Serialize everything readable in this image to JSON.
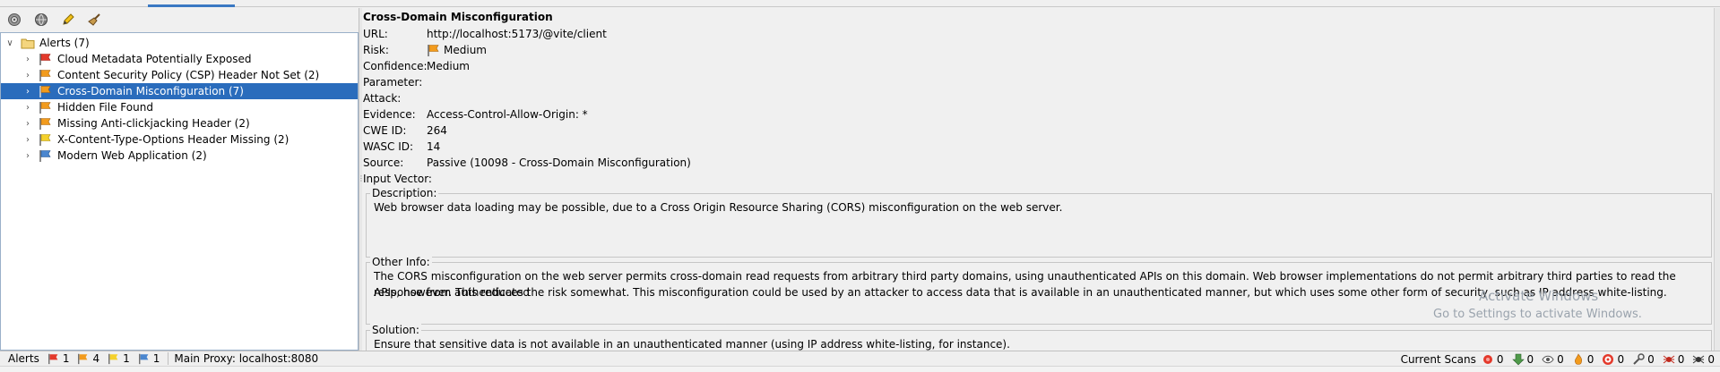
{
  "tree": {
    "root_label": "Alerts (7)",
    "items": [
      {
        "label": "Cloud Metadata Potentially Exposed",
        "flag": "#e4392b"
      },
      {
        "label": "Content Security Policy (CSP) Header Not Set (2)",
        "flag": "#f29b1d"
      },
      {
        "label": "Cross-Domain Misconfiguration (7)",
        "flag": "#f29b1d"
      },
      {
        "label": "Hidden File Found",
        "flag": "#f29b1d"
      },
      {
        "label": "Missing Anti-clickjacking Header (2)",
        "flag": "#f29b1d"
      },
      {
        "label": "X-Content-Type-Options Header Missing (2)",
        "flag": "#f5d12b"
      },
      {
        "label": "Modern Web Application (2)",
        "flag": "#4a86cf"
      }
    ]
  },
  "detail": {
    "title": "Cross-Domain Misconfiguration",
    "fields": {
      "url_label": "URL:",
      "url": "http://localhost:5173/@vite/client",
      "risk_label": "Risk:",
      "risk": "Medium",
      "confidence_label": "Confidence:",
      "confidence": "Medium",
      "parameter_label": "Parameter:",
      "attack_label": "Attack:",
      "evidence_label": "Evidence:",
      "evidence": "Access-Control-Allow-Origin: *",
      "cwe_label": "CWE ID:",
      "cwe": "264",
      "wasc_label": "WASC ID:",
      "wasc": "14",
      "source_label": "Source:",
      "source": "Passive (10098 - Cross-Domain Misconfiguration)",
      "input_vector_label": "Input Vector:"
    },
    "description": {
      "label": "Description:",
      "text": "Web browser data loading may be possible, due to a Cross Origin Resource Sharing (CORS) misconfiguration on the web server."
    },
    "other_info": {
      "label": "Other Info:",
      "line1": "The CORS misconfiguration on the web server permits cross-domain read requests from arbitrary third party domains, using unauthenticated APIs on this domain. Web browser implementations do not permit arbitrary third parties to read the response from authenticated",
      "line2": "APIs, however. This reduces the risk somewhat. This misconfiguration could be used by an attacker to access data that is available in an unauthenticated manner, but which uses some other form of security, such as IP address white-listing."
    },
    "solution": {
      "label": "Solution:",
      "text": "Ensure that sensitive data is not available in an unauthenticated manner (using IP address white-listing, for instance)."
    }
  },
  "watermark": {
    "line1": "Activate Windows",
    "line2": "Go to Settings to activate Windows."
  },
  "status": {
    "alerts_label": "Alerts",
    "alert_counts": [
      {
        "color": "#e4392b",
        "count": "1"
      },
      {
        "color": "#f29b1d",
        "count": "4"
      },
      {
        "color": "#f5d12b",
        "count": "1"
      },
      {
        "color": "#4a86cf",
        "count": "1"
      }
    ],
    "proxy": "Main Proxy: localhost:8080",
    "current_scans_label": "Current Scans",
    "scan_counts": [
      "0",
      "0",
      "0",
      "0",
      "0",
      "0",
      "0",
      "0"
    ]
  }
}
